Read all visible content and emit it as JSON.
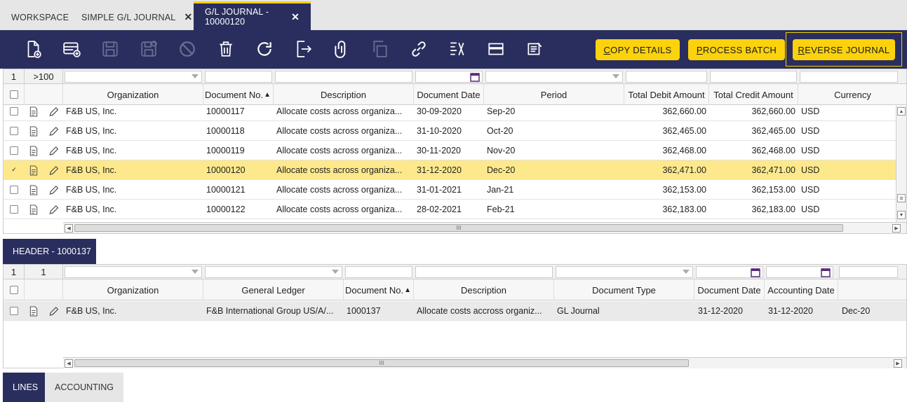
{
  "tabs": [
    {
      "label": "WORKSPACE"
    },
    {
      "label": "SIMPLE G/L JOURNAL"
    },
    {
      "label": "G/L JOURNAL - 10000120"
    }
  ],
  "toolbar": {
    "copy_details": "OPY DETAILS",
    "copy_details_accel": "C",
    "process_batch": "ROCESS BATCH",
    "process_batch_accel": "P",
    "reverse_journal": "EVERSE JOURNAL",
    "reverse_journal_accel": "R",
    "icons": [
      "new-document-icon",
      "new-row-icon",
      "save-icon",
      "save-close-icon",
      "cancel-icon",
      "delete-icon",
      "refresh-icon",
      "export-icon",
      "attachment-icon",
      "copy-record-icon",
      "link-icon",
      "tree-icon",
      "grid-view-icon",
      "audit-icon"
    ]
  },
  "top_grid": {
    "page_num": "1",
    "row_count": ">100",
    "columns": [
      "Organization",
      "Document No.",
      "Description",
      "Document Date",
      "Period",
      "Total Debit Amount",
      "Total Credit Amount",
      "Currency"
    ],
    "sort_indicator": "▲",
    "rows": [
      {
        "org": "F&B US, Inc.",
        "doc": "10000117",
        "desc": "Allocate costs across organiza...",
        "date": "30-09-2020",
        "period": "Sep-20",
        "debit": "362,660.00",
        "credit": "362,660.00",
        "cur": "USD",
        "selected": false
      },
      {
        "org": "F&B US, Inc.",
        "doc": "10000118",
        "desc": "Allocate costs across organiza...",
        "date": "31-10-2020",
        "period": "Oct-20",
        "debit": "362,465.00",
        "credit": "362,465.00",
        "cur": "USD",
        "selected": false
      },
      {
        "org": "F&B US, Inc.",
        "doc": "10000119",
        "desc": "Allocate costs across organiza...",
        "date": "30-11-2020",
        "period": "Nov-20",
        "debit": "362,468.00",
        "credit": "362,468.00",
        "cur": "USD",
        "selected": false
      },
      {
        "org": "F&B US, Inc.",
        "doc": "10000120",
        "desc": "Allocate costs across organiza...",
        "date": "31-12-2020",
        "period": "Dec-20",
        "debit": "362,471.00",
        "credit": "362,471.00",
        "cur": "USD",
        "selected": true
      },
      {
        "org": "F&B US, Inc.",
        "doc": "10000121",
        "desc": "Allocate costs across organiza...",
        "date": "31-01-2021",
        "period": "Jan-21",
        "debit": "362,153.00",
        "credit": "362,153.00",
        "cur": "USD",
        "selected": false
      },
      {
        "org": "F&B US, Inc.",
        "doc": "10000122",
        "desc": "Allocate costs across organiza...",
        "date": "28-02-2021",
        "period": "Feb-21",
        "debit": "362,183.00",
        "credit": "362,183.00",
        "cur": "USD",
        "selected": false
      }
    ]
  },
  "header_section": {
    "label": "HEADER - 1000137"
  },
  "bottom_grid": {
    "page_num": "1",
    "row_count": "1",
    "columns": [
      "Organization",
      "General Ledger",
      "Document No.",
      "Description",
      "Document Type",
      "Document Date",
      "Accounting Date"
    ],
    "sort_indicator": "▲",
    "rows": [
      {
        "org": "F&B US, Inc.",
        "gl": "F&B International Group US/A/...",
        "doc": "1000137",
        "desc": "Allocate costs accross organiz...",
        "type": "GL Journal",
        "date": "31-12-2020",
        "acct": "31-12-2020",
        "period": "Dec-20"
      }
    ]
  },
  "bottom_tabs": [
    {
      "label": "LINES"
    },
    {
      "label": "ACCOUNTING"
    }
  ],
  "colors": {
    "navy": "#2a2e5e",
    "yellow": "#fcd20c",
    "selected_row": "#fde98c",
    "calendar": "#5a2a7a"
  }
}
